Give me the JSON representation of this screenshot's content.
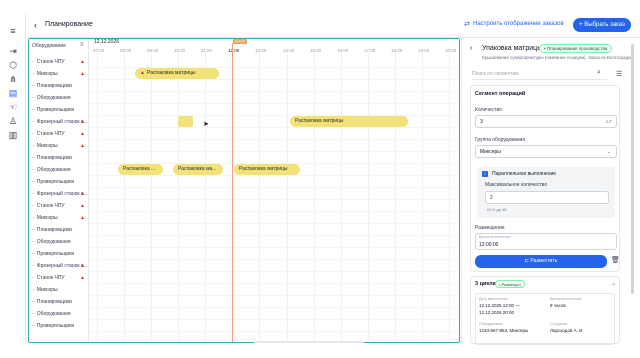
{
  "header": {
    "back_glyph": "‹",
    "title": "Планирование",
    "configure_label": "Настроить отображение заказов",
    "choose_order_label": "+ Выбрать заказ"
  },
  "left_table": {
    "header": "Оборудование",
    "rows": [
      {
        "label": "Станок ЧПУ",
        "warn": true
      },
      {
        "label": "Миксеры",
        "warn": true
      },
      {
        "label": "Планировщики",
        "warn": false
      },
      {
        "label": "Оборудование",
        "warn": false
      },
      {
        "label": "Проверяльщики",
        "warn": false
      },
      {
        "label": "Фрезерный станок с...",
        "warn": true
      },
      {
        "label": "Станок ЧПУ",
        "warn": true
      },
      {
        "label": "Миксеры",
        "warn": true
      },
      {
        "label": "Планировщики",
        "warn": false
      },
      {
        "label": "Оборудование",
        "warn": false
      },
      {
        "label": "Проверяльщики",
        "warn": false
      },
      {
        "label": "Фрезерный станок с...",
        "warn": true
      },
      {
        "label": "Станок ЧПУ",
        "warn": true
      },
      {
        "label": "Миксеры",
        "warn": true
      },
      {
        "label": "Планировщики",
        "warn": false
      },
      {
        "label": "Оборудование",
        "warn": false
      },
      {
        "label": "Проверяльщики",
        "warn": false
      },
      {
        "label": "Фрезерный станок с...",
        "warn": true
      },
      {
        "label": "Станок ЧПУ",
        "warn": true
      },
      {
        "label": "Миксеры",
        "warn": false
      },
      {
        "label": "Планировщики",
        "warn": false
      },
      {
        "label": "Оборудование",
        "warn": false
      },
      {
        "label": "Проверяльщики",
        "warn": false
      }
    ]
  },
  "timeline": {
    "date": "12.12.2025",
    "hours": [
      "07:00",
      "08:00",
      "09:00",
      "10:00",
      "11:00",
      "12:00",
      "13:00",
      "14:00",
      "15:00",
      "16:00",
      "17:00",
      "18:00",
      "19:00",
      "20:00"
    ],
    "now_label": "Сейчас",
    "bars": [
      {
        "label": "Распаковка матрицы",
        "warn": true
      },
      {
        "label": "",
        "warn": false
      },
      {
        "label": "Распаковка матрицы",
        "warn": false
      },
      {
        "label": "Распаковка ...",
        "warn": false
      },
      {
        "label": "Распаковка ма...",
        "warn": false
      },
      {
        "label": "Распаковка матрицы",
        "warn": false
      }
    ]
  },
  "panel": {
    "title": "Упаковка матрицы",
    "status_badge": "• Планирование производства",
    "subtitle": "Крышевание супергарнитуры (название позиции). Заказ из Волгограда",
    "search_placeholder": "Поиск по сегментам",
    "segment": {
      "title": "Сегмент операций",
      "quantity_label": "Количество",
      "quantity_value": "3",
      "quantity_unit": "шт",
      "group_label": "Группа оборудования",
      "group_value": "Миксеры",
      "parallel_label": "Параллельное выполнение",
      "max_label": "Максимальное количество",
      "max_value": "2",
      "max_hint": "От 2 до 15",
      "placement_label": "Размещение",
      "time_label": "Время выполнения",
      "time_value": "12:00:00",
      "place_button": "Разместить"
    },
    "cycles": {
      "title": "3 цикла",
      "badge": "• Размещен",
      "start_label": "Дата выполнения",
      "start_value_1": "12.12.2025 12:00 —",
      "start_value_2": "12.12.2026 20:00",
      "time_label": "Время выполнения",
      "time_value": "8 часов",
      "equipment_label": "Оборудование",
      "equipment_value": "1234-567-863, Миксеры",
      "worker_label": "Сотрудник",
      "worker_value": "Ларсходов А. И."
    }
  },
  "colors": {
    "accent": "#2563eb",
    "bar": "#f3e27a",
    "now_line": "#f59e7a",
    "frame": "#3aa7b8",
    "warning": "#dc2626"
  },
  "icons": [
    "grid-menu-icon",
    "login-icon",
    "cube-icon",
    "share-nodes-icon",
    "chart-icon",
    "hand-icon",
    "user-icon",
    "building-icon"
  ]
}
